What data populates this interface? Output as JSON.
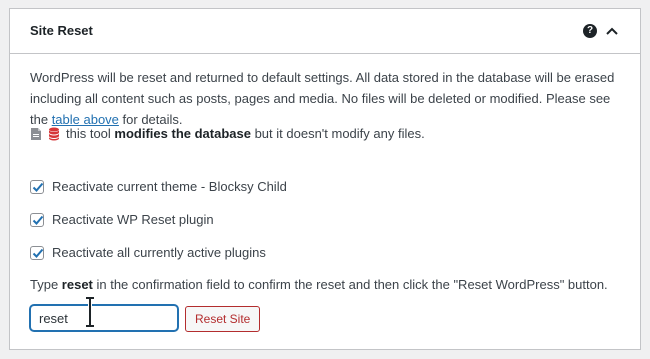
{
  "panel": {
    "title": "Site Reset",
    "help_icon": "question-circle-icon",
    "collapse_icon": "chevron-up-icon"
  },
  "description": {
    "text_before_link": "WordPress will be reset and returned to default settings. All data stored in the database will be erased including all content such as posts, pages and media. No files will be deleted or modified. Please see the ",
    "link_text": "table above",
    "text_after_link": " for details."
  },
  "note": {
    "icons": [
      "document-icon",
      "database-icon"
    ],
    "prefix": "this tool ",
    "emphasis": "modifies the database",
    "suffix": " but it doesn't modify any files.",
    "database_icon_color": "#d63638"
  },
  "options": [
    {
      "label": "Reactivate current theme - Blocksy Child",
      "checked": true
    },
    {
      "label": "Reactivate WP Reset plugin",
      "checked": true
    },
    {
      "label": "Reactivate all currently active plugins",
      "checked": true
    }
  ],
  "confirmation": {
    "prefix": "Type ",
    "keyword": "reset",
    "suffix": " in the confirmation field to confirm the reset and then click the \"Reset WordPress\" button.",
    "input_value": "reset"
  },
  "reset_button": {
    "label": "Reset Site",
    "color": "#b32d2e"
  },
  "accent_color": "#2271b1"
}
